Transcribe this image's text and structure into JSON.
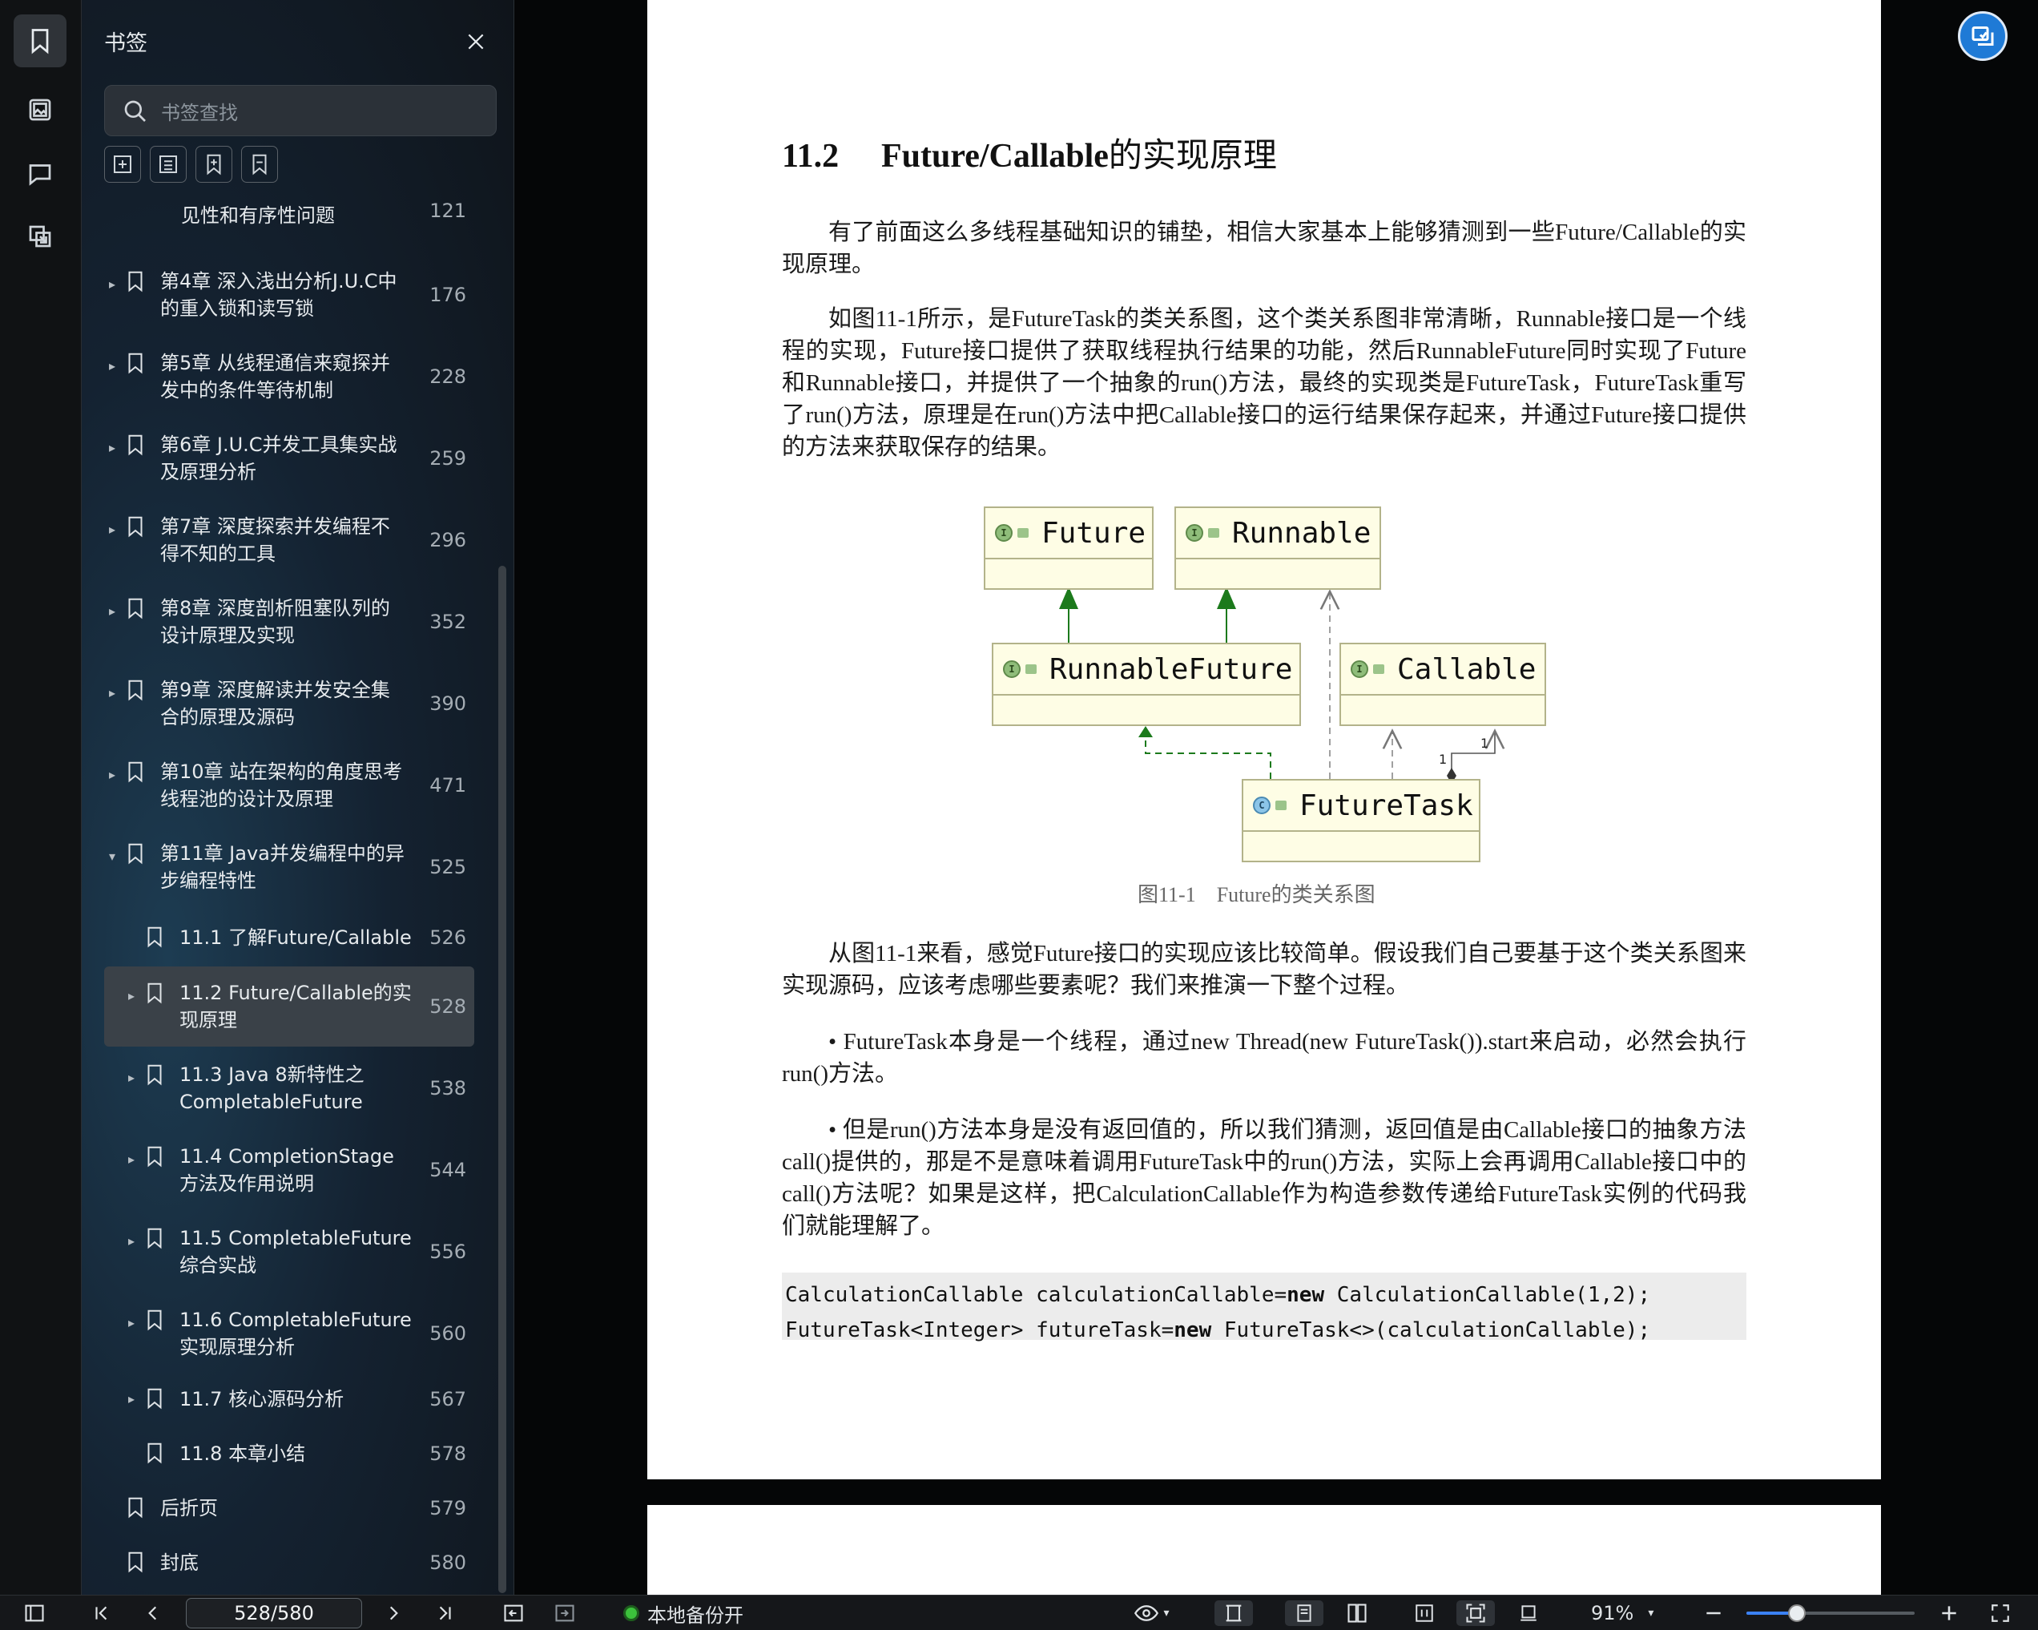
{
  "panel": {
    "title": "书签",
    "search_placeholder": "书签查找"
  },
  "bookmarks": [
    {
      "label": "见性和有序性问题",
      "page": "121"
    },
    {
      "label": "第4章 深入浅出分析J.U.C中的重入锁和读写锁",
      "page": "176"
    },
    {
      "label": "第5章 从线程通信来窥探并发中的条件等待机制",
      "page": "228"
    },
    {
      "label": "第6章 J.U.C并发工具集实战及原理分析",
      "page": "259"
    },
    {
      "label": "第7章 深度探索并发编程不得不知的工具",
      "page": "296"
    },
    {
      "label": "第8章 深度剖析阻塞队列的设计原理及实现",
      "page": "352"
    },
    {
      "label": "第9章 深度解读并发安全集合的原理及源码",
      "page": "390"
    },
    {
      "label": "第10章 站在架构的角度思考线程池的设计及原理",
      "page": "471"
    },
    {
      "label": "第11章 Java并发编程中的异步编程特性",
      "page": "525"
    },
    {
      "label": "11.1 了解Future/Callable",
      "page": "526"
    },
    {
      "label": "11.2 Future/Callable的实现原理",
      "page": "528"
    },
    {
      "label": "11.3 Java 8新特性之CompletableFuture",
      "page": "538"
    },
    {
      "label": "11.4 CompletionStage方法及作用说明",
      "page": "544"
    },
    {
      "label": "11.5 CompletableFuture综合实战",
      "page": "556"
    },
    {
      "label": "11.6 CompletableFuture实现原理分析",
      "page": "560"
    },
    {
      "label": "11.7 核心源码分析",
      "page": "567"
    },
    {
      "label": "11.8 本章小结",
      "page": "578"
    },
    {
      "label": "后折页",
      "page": "579"
    },
    {
      "label": "封底",
      "page": "580"
    }
  ],
  "document": {
    "section_number": "11.2",
    "section_title_en": "Future/Callable",
    "section_title_cn": "的实现原理",
    "para1": "有了前面这么多线程基础知识的铺垫，相信大家基本上能够猜测到一些Future/Callable的实现原理。",
    "para2": "如图11-1所示，是FutureTask的类关系图，这个类关系图非常清晰，Runnable接口是一个线程的实现，Future接口提供了获取线程执行结果的功能，然后RunnableFuture同时实现了Future和Runnable接口，并提供了一个抽象的run()方法，最终的实现类是FutureTask，FutureTask重写了run()方法，原理是在run()方法中把Callable接口的运行结果保存起来，并通过Future接口提供的方法来获取保存的结果。",
    "figure": {
      "classes": [
        "Future",
        "Runnable",
        "RunnableFuture",
        "Callable",
        "FutureTask"
      ],
      "multiplicity_left": "1",
      "multiplicity_right": "1",
      "caption": "图11-1　Future的类关系图"
    },
    "para3": "从图11-1来看，感觉Future接口的实现应该比较简单。假设我们自己要基于这个类关系图来实现源码，应该考虑哪些要素呢？我们来推演一下整个过程。",
    "para4": "• FutureTask本身是一个线程，通过new Thread(new FutureTask()).start来启动，必然会执行run()方法。",
    "para5": "•  但是run()方法本身是没有返回值的，所以我们猜测，返回值是由Callable接口的抽象方法call()提供的，那是不是意味着调用FutureTask中的run()方法，实际上会再调用Callable接口中的call()方法呢？如果是这样，把CalculationCallable作为构造参数传递给FutureTask实例的代码我们就能理解了。",
    "code": {
      "line1_a": "CalculationCallable calculationCallable=",
      "line1_kw": "new",
      "line1_b": " CalculationCallable(1,2);",
      "line2_a": "FutureTask<Integer> futureTask=",
      "line2_kw": "new",
      "line2_b": " FutureTask<>(calculationCallable);"
    }
  },
  "statusbar": {
    "page_indicator": "528/580",
    "backup_status": "本地备份开",
    "zoom": "91%",
    "zoom_slider_fraction": 0.3
  },
  "colors": {
    "accent": "#3b82f6",
    "backup_dot": "#3cc23c",
    "uml_fill": "#fefde5"
  }
}
